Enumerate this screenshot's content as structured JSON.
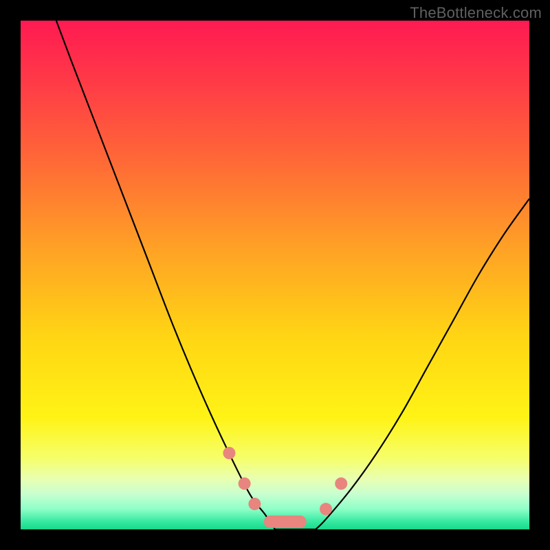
{
  "watermark": "TheBottleneck.com",
  "chart_data": {
    "type": "line",
    "title": "",
    "xlabel": "",
    "ylabel": "",
    "xlim": [
      0,
      100
    ],
    "ylim": [
      0,
      100
    ],
    "series": [
      {
        "name": "left-curve",
        "x": [
          7,
          10,
          15,
          20,
          25,
          30,
          35,
          40,
          45,
          48,
          50
        ],
        "y": [
          100,
          92,
          79,
          66,
          53,
          40,
          28,
          17,
          7,
          3,
          0
        ]
      },
      {
        "name": "right-curve",
        "x": [
          58,
          60,
          65,
          70,
          75,
          80,
          85,
          90,
          95,
          100
        ],
        "y": [
          0,
          2,
          8,
          15,
          23,
          32,
          41,
          50,
          58,
          65
        ]
      },
      {
        "name": "floor",
        "x": [
          50,
          58
        ],
        "y": [
          0,
          0
        ]
      }
    ],
    "markers": {
      "comment": "pink rounded markers near the minimum of the V",
      "points": [
        {
          "x": 41,
          "y": 15
        },
        {
          "x": 44,
          "y": 9
        },
        {
          "x": 46,
          "y": 5
        },
        {
          "x": 52,
          "y": 1.5,
          "wide": true
        },
        {
          "x": 60,
          "y": 4
        },
        {
          "x": 63,
          "y": 9
        }
      ],
      "color": "#e8857e"
    },
    "background": {
      "type": "vertical-gradient",
      "stops": [
        {
          "pos": 0.0,
          "color": "#ff1a52"
        },
        {
          "pos": 0.12,
          "color": "#ff3a47"
        },
        {
          "pos": 0.28,
          "color": "#ff6a36"
        },
        {
          "pos": 0.45,
          "color": "#ffa225"
        },
        {
          "pos": 0.62,
          "color": "#ffd514"
        },
        {
          "pos": 0.78,
          "color": "#fff315"
        },
        {
          "pos": 0.86,
          "color": "#f6ff6a"
        },
        {
          "pos": 0.9,
          "color": "#e9ffb0"
        },
        {
          "pos": 0.93,
          "color": "#c9ffd0"
        },
        {
          "pos": 0.96,
          "color": "#8effc8"
        },
        {
          "pos": 0.985,
          "color": "#35e9a0"
        },
        {
          "pos": 1.0,
          "color": "#17d98b"
        }
      ]
    }
  }
}
